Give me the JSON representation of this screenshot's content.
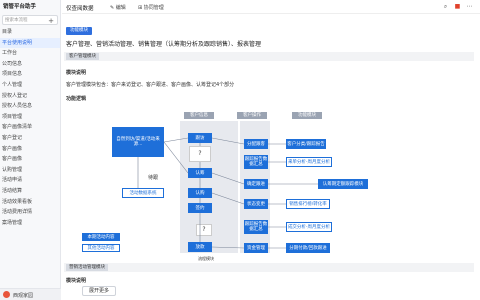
{
  "sidebar": {
    "title": "销管平台助手",
    "search_placeholder": "搜索本流程",
    "items": [
      {
        "label": "目录"
      },
      {
        "label": "平台使用说明",
        "active": true
      },
      {
        "label": "工作台"
      },
      {
        "label": "公司信息"
      },
      {
        "label": "项目信息"
      },
      {
        "label": "个人管理"
      },
      {
        "label": "授权人登记"
      },
      {
        "label": "授权人员信息"
      },
      {
        "label": "项目管理"
      },
      {
        "label": "客户画像清单"
      },
      {
        "label": "客户登记"
      },
      {
        "label": "客户画像"
      },
      {
        "label": "客户画像"
      },
      {
        "label": "认购管理"
      },
      {
        "label": "活动申请"
      },
      {
        "label": "活动结算"
      },
      {
        "label": "活动效果看板"
      },
      {
        "label": "活动费用详情"
      },
      {
        "label": "案场管理"
      }
    ],
    "user_name": "西观家园"
  },
  "topbar": {
    "title": "仅查阅数据",
    "edit_label": "编辑",
    "share_label": "协同管理"
  },
  "main": {
    "tag1": "功能模块",
    "headline": "客户管理、营销活动管理、销售管理（认筹期分析及跟踪销售）、报表管理",
    "section1_header": "客户管理模块",
    "mod_desc_title": "模块说明",
    "mod_desc_text": "客户管理模块包含：客户来访登记、客户跟进、客户画像、认筹登记4个部分",
    "flow_title": "功能逻辑",
    "section2_header": "营销活动管理模块",
    "mod_desc_title2": "模块说明",
    "bottom_button": "展开更多"
  },
  "diagram": {
    "col_headers": [
      "客户信息",
      "客户操作",
      "功能模块"
    ],
    "left_box": "自然到访/渠道/活动来源...",
    "left_label": "待跟",
    "left_box2": "活动数据系统",
    "left_small_1": "本期活动内容",
    "left_small_2": "其他活动内容",
    "mid_boxes": [
      "跟访",
      "认筹",
      "认购",
      "签约",
      "放款"
    ],
    "q_mark": "?",
    "mid_bottom_label": "流程模块",
    "right_boxes": [
      "分配跟客",
      "跟踪报告数据汇总",
      "确定跟进",
      "状态变更",
      "跟踪报告数据汇总",
      "资金管理"
    ],
    "far_boxes": [
      "客户分类/跟踪报告",
      "来单分析-周月度分析",
      "认筹期定额跟踪模块",
      "销售排行榜/转化率",
      "成交分析-周月度分析",
      "分期付款/回款跟进"
    ]
  }
}
